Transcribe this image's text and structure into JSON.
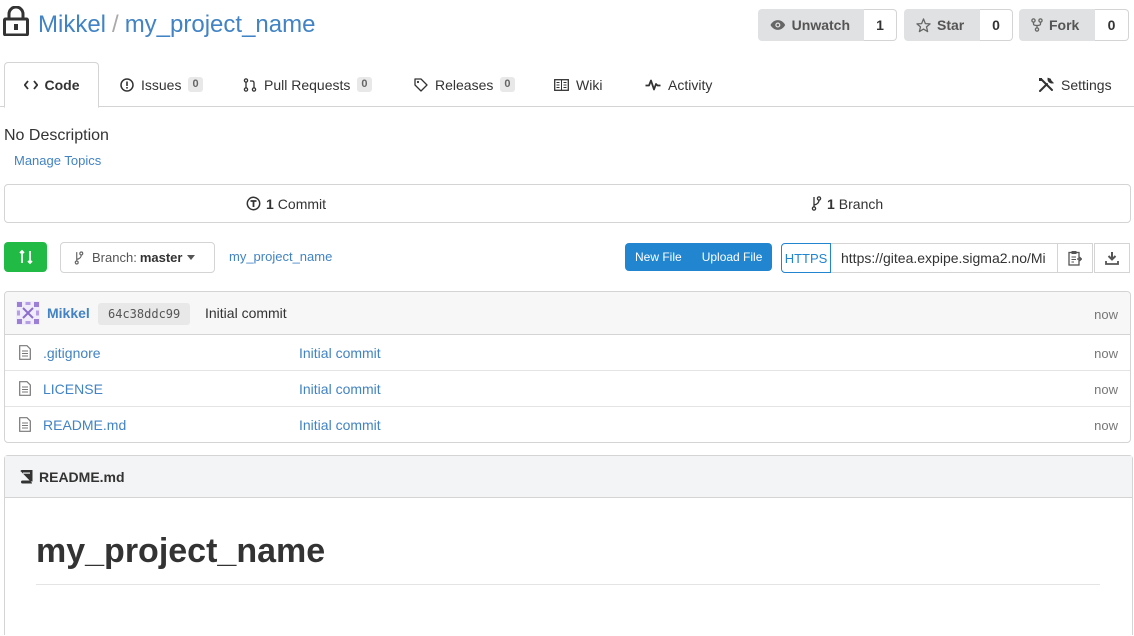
{
  "repo": {
    "owner": "Mikkel",
    "separator": "/",
    "name": "my_project_name"
  },
  "actions": {
    "watch": {
      "label": "Unwatch",
      "count": "1"
    },
    "star": {
      "label": "Star",
      "count": "0"
    },
    "fork": {
      "label": "Fork",
      "count": "0"
    }
  },
  "tabs": [
    {
      "label": "Code",
      "icon": "code-icon"
    },
    {
      "label": "Issues",
      "badge": "0",
      "icon": "issue-icon"
    },
    {
      "label": "Pull Requests",
      "badge": "0",
      "icon": "pull-request-icon"
    },
    {
      "label": "Releases",
      "badge": "0",
      "icon": "tag-icon"
    },
    {
      "label": "Wiki",
      "icon": "book-icon"
    },
    {
      "label": "Activity",
      "icon": "pulse-icon"
    },
    {
      "label": "Settings",
      "icon": "tools-icon"
    }
  ],
  "description": "No Description",
  "manage_topics": "Manage Topics",
  "stats": {
    "commits_count": "1",
    "commits_label": "Commit",
    "branches_count": "1",
    "branches_label": "Branch"
  },
  "toolbar": {
    "branch_prefix": "Branch:",
    "branch_name": "master",
    "path": "my_project_name",
    "new_file": "New File",
    "upload_file": "Upload File",
    "protocol": "HTTPS",
    "clone_url": "https://gitea.expipe.sigma2.no/Mi"
  },
  "latest_commit": {
    "author": "Mikkel",
    "sha": "64c38ddc99",
    "message": "Initial commit",
    "time": "now"
  },
  "files": [
    {
      "name": ".gitignore",
      "message": "Initial commit",
      "time": "now"
    },
    {
      "name": "LICENSE",
      "message": "Initial commit",
      "time": "now"
    },
    {
      "name": "README.md",
      "message": "Initial commit",
      "time": "now"
    }
  ],
  "readme": {
    "filename": "README.md",
    "heading": "my_project_name"
  },
  "colors": {
    "link": "#4183c4",
    "primary": "#2185d0",
    "green": "#21ba45"
  }
}
